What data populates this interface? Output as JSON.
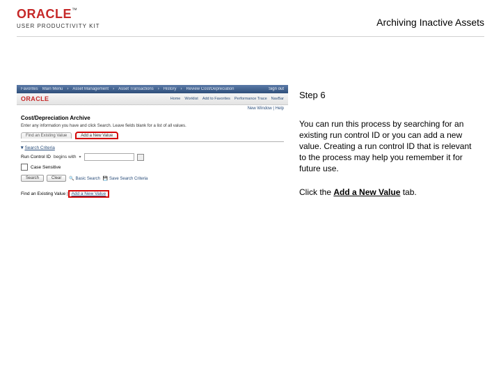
{
  "header": {
    "brand": "ORACLE",
    "tm": "™",
    "sub": "USER PRODUCTIVITY KIT",
    "title": "Archiving Inactive Assets"
  },
  "instructions": {
    "step": "Step 6",
    "body": "You can run this process by searching for an existing run control ID or you can add a new value. Creating a run control ID that is relevant to the process may help you remember it for future use.",
    "action_prefix": "Click the ",
    "action_target": "Add a New Value",
    "action_suffix": " tab."
  },
  "embedded": {
    "topnav": {
      "items": [
        "Favorites",
        "Main Menu",
        "Asset Management",
        "Asset Transactions",
        "History",
        "Review Cost/Depreciation"
      ],
      "signout": "Sign out"
    },
    "brand": "ORACLE",
    "subnav": [
      "Home",
      "Worklist",
      "Add to Favorites",
      "Performance Trace",
      "NavBar"
    ],
    "new_window": "New Window | Help",
    "page_title": "Cost/Depreciation Archive",
    "page_desc": "Enter any information you have and click Search. Leave fields blank for a list of all values.",
    "tabs": {
      "find": "Find an Existing Value",
      "add": "Add a New Value"
    },
    "search_criteria_label": "Search Criteria",
    "fields": {
      "run_control_label": "Run Control ID",
      "run_control_op": "begins with",
      "case_label": "Case Sensitive"
    },
    "buttons": {
      "search": "Search",
      "clear": "Clear",
      "basic": "Basic Search",
      "save": "Save Search Criteria"
    },
    "bottom_link": {
      "label": "Find an Existing Value",
      "sep": " | ",
      "add": "Add a New Value"
    }
  }
}
